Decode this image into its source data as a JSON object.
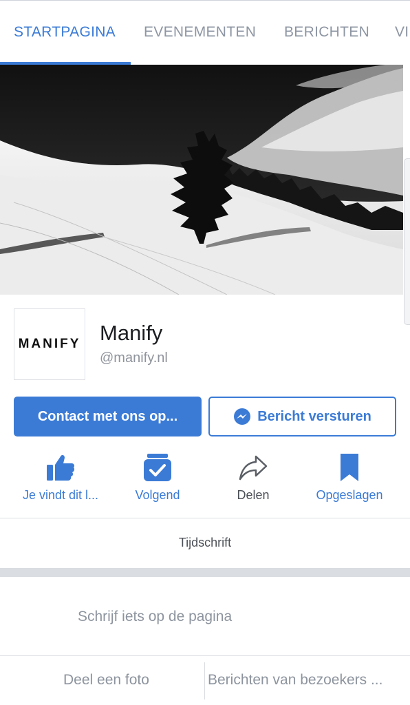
{
  "tabs": [
    {
      "label": "STARTPAGINA",
      "active": true
    },
    {
      "label": "EVENEMENTEN",
      "active": false
    },
    {
      "label": "BERICHTEN",
      "active": false
    },
    {
      "label": "VI",
      "active": false
    }
  ],
  "page": {
    "logo_text": "MANIFY",
    "name": "Manify",
    "handle": "@manify.nl"
  },
  "buttons": {
    "contact_label": "Contact met ons op...",
    "message_label": "Bericht versturen"
  },
  "actions": [
    {
      "label": "Je vindt dit l...",
      "icon": "thumbs-up-icon"
    },
    {
      "label": "Volgend",
      "icon": "following-check-icon"
    },
    {
      "label": "Delen",
      "icon": "share-arrow-icon"
    },
    {
      "label": "Opgeslagen",
      "icon": "bookmark-icon"
    }
  ],
  "timeline_label": "Tijdschrift",
  "composer": {
    "placeholder": "Schrijf iets op de pagina"
  },
  "bottom": {
    "photo_label": "Deel een foto",
    "visitors_label": "Berichten van bezoekers ..."
  },
  "colors": {
    "accent": "#3b7bd6",
    "muted": "#8d949e"
  }
}
